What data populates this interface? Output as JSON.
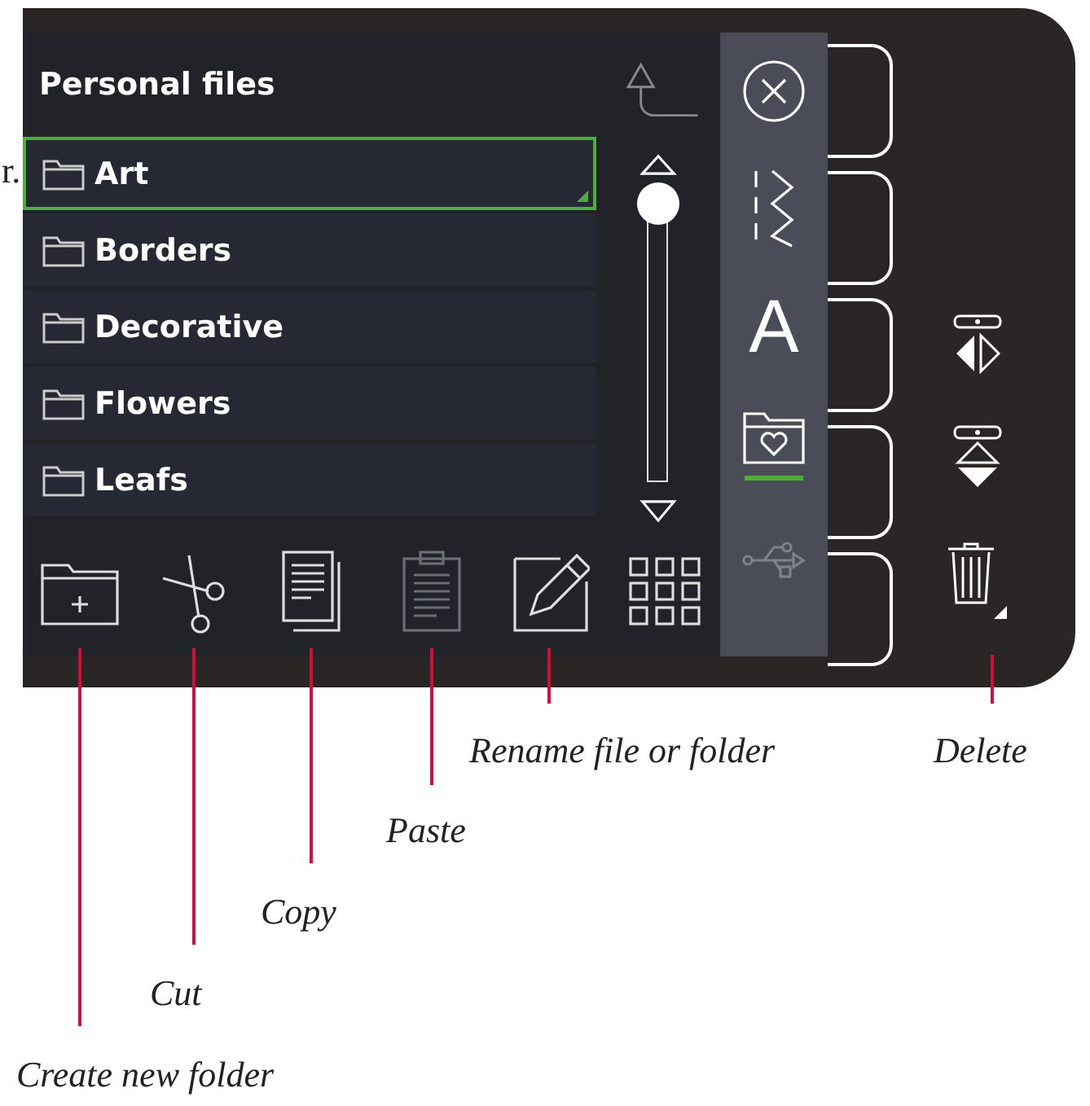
{
  "edge_fragment": "r.",
  "file_list": {
    "title": "Personal files",
    "items": [
      {
        "label": "Art",
        "selected": true
      },
      {
        "label": "Borders",
        "selected": false
      },
      {
        "label": "Decorative",
        "selected": false
      },
      {
        "label": "Flowers",
        "selected": false
      },
      {
        "label": "Leafs",
        "selected": false
      }
    ]
  },
  "toolbar": [
    {
      "kind": "new-folder",
      "disabled": false
    },
    {
      "kind": "cut",
      "disabled": false
    },
    {
      "kind": "copy",
      "disabled": false
    },
    {
      "kind": "paste",
      "disabled": true
    },
    {
      "kind": "rename",
      "disabled": false
    },
    {
      "kind": "grid",
      "disabled": false
    }
  ],
  "sidebar": [
    {
      "kind": "close",
      "selected": false,
      "disabled": false
    },
    {
      "kind": "stitch",
      "selected": false,
      "disabled": false
    },
    {
      "kind": "letter",
      "glyph": "A",
      "selected": false,
      "disabled": false
    },
    {
      "kind": "folder",
      "selected": true,
      "disabled": false
    },
    {
      "kind": "usb",
      "selected": false,
      "disabled": true
    }
  ],
  "callouts": [
    {
      "label": "Create new folder"
    },
    {
      "label": "Cut"
    },
    {
      "label": "Copy"
    },
    {
      "label": "Paste"
    },
    {
      "label": "Rename file or folder"
    },
    {
      "label": "Delete"
    }
  ]
}
